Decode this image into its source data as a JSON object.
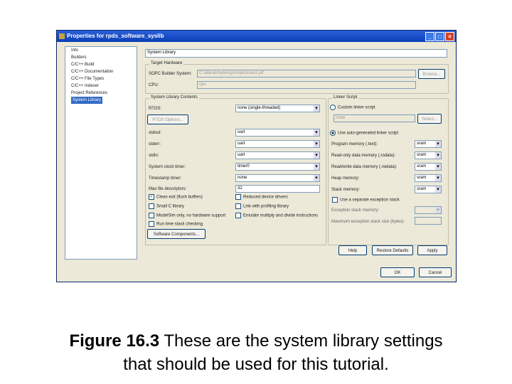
{
  "window": {
    "title": "Properties for rpds_software_syslib"
  },
  "tree": [
    "Info",
    "Builders",
    "C/C++ Build",
    "C/C++ Documentation",
    "C/C++ File Types",
    "C/C++ Indexer",
    "Project References",
    "System Library"
  ],
  "page_title": "System Library",
  "target": {
    "label": "Target Hardware",
    "sopc_label": "SOPC Builder System:",
    "sopc_value": "C:\\altera\\mydesigns\\rpds\\nios2.ptf",
    "browse": "Browse...",
    "cpu_label": "CPU:",
    "cpu_value": "cpu"
  },
  "contents": {
    "label": "System Library Contents",
    "rtos_label": "RTOS:",
    "rtos_value": "none (single-threaded)",
    "rtos_options": "RTOS Options...",
    "fields": [
      {
        "label": "stdout:",
        "value": "uart"
      },
      {
        "label": "stderr:",
        "value": "uart"
      },
      {
        "label": "stdin:",
        "value": "uart"
      },
      {
        "label": "System clock timer:",
        "value": "timer0"
      },
      {
        "label": "Timestamp timer:",
        "value": "none"
      }
    ],
    "maxfd_label": "Max file descriptors:",
    "maxfd_value": "32",
    "checks": [
      {
        "label": "Clean exit (flush buffers)",
        "checked": true
      },
      {
        "label": "Reduced device drivers",
        "checked": false
      },
      {
        "label": "Small C library",
        "checked": false
      },
      {
        "label": "Link with profiling library",
        "checked": false
      },
      {
        "label": "ModelSim only, no hardware support",
        "checked": false
      },
      {
        "label": "Emulate multiply and divide instructions",
        "checked": false
      },
      {
        "label": "Run time stack checking",
        "checked": false
      }
    ],
    "software_components": "Software Components..."
  },
  "linker": {
    "label": "Linker Script",
    "custom": "Custom linker script",
    "custom_value": "none",
    "select": "Select...",
    "auto": "Use auto-generated linker script",
    "mems": [
      {
        "label": "Program memory (.text):",
        "value": "sram"
      },
      {
        "label": "Read-only data memory (.rodata):",
        "value": "sram"
      },
      {
        "label": "Read/write data memory (.rwdata):",
        "value": "sram"
      },
      {
        "label": "Heap memory:",
        "value": "sram"
      },
      {
        "label": "Stack memory:",
        "value": "sram"
      }
    ],
    "sep_stack": "Use a separate exception stack",
    "exc_mem": "Exception stack memory:",
    "exc_size": "Maximum exception stack size (bytes):"
  },
  "buttons": {
    "help": "Help",
    "restore": "Restore Defaults",
    "apply": "Apply",
    "ok": "OK",
    "cancel": "Cancel"
  },
  "caption": {
    "bold": "Figure 16.3",
    "line1": " These are the system library settings",
    "line2": "that should be used for this tutorial."
  }
}
